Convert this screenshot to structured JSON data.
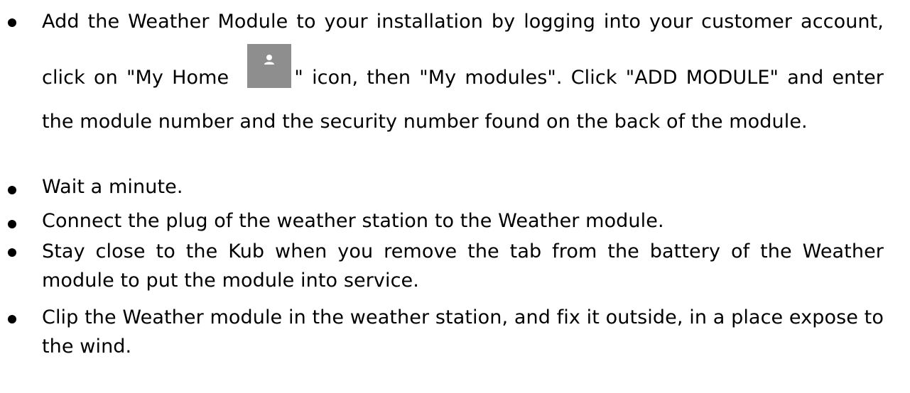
{
  "instructions": {
    "items": [
      {
        "part1": " Add the Weather Module to your installation by logging into your customer account, click on \"My Home ",
        "icon": "user-profile-icon",
        "part2": "\" icon, then \"My modules\". Click \"ADD MODULE\" and enter the module number and the security number found on the back of the module."
      },
      {
        "text": "Wait a minute."
      },
      {
        "text": "Connect the plug of the weather station to the Weather module."
      },
      {
        "text": "Stay close to the Kub when you remove the tab from the battery of the Weather module to put the module into service."
      },
      {
        "text": "Clip the Weather module in the weather station, and fix it outside, in a place expose to the wind."
      }
    ]
  },
  "colors": {
    "text": "#000000",
    "icon_background": "#8e8e8e",
    "icon_glyph": "#ffffff"
  }
}
